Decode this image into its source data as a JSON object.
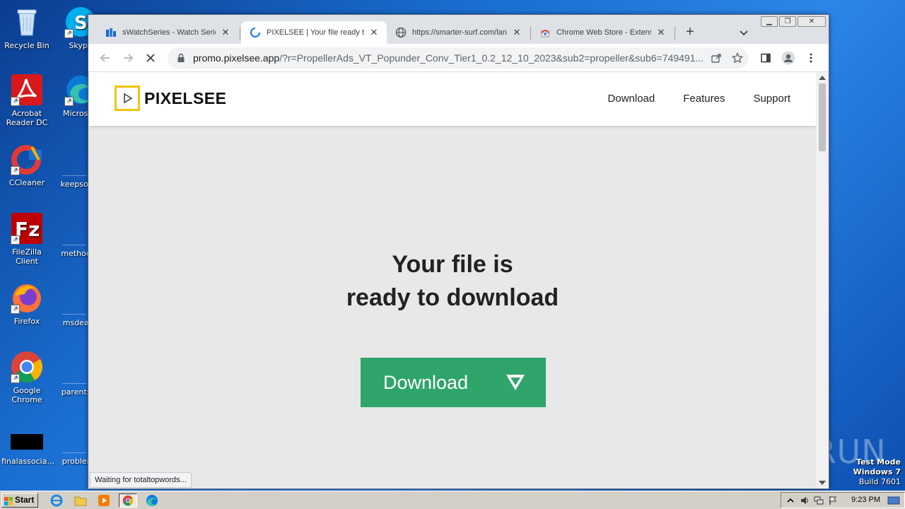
{
  "desktop": {
    "icons": [
      {
        "label": "Recycle Bin"
      },
      {
        "label": "Skype"
      },
      {
        "label": "Acrobat Reader DC"
      },
      {
        "label": "Microsoft"
      },
      {
        "label": "CCleaner"
      },
      {
        "label": "keepsome"
      },
      {
        "label": "FileZilla Client"
      },
      {
        "label": "methodsp"
      },
      {
        "label": "Firefox"
      },
      {
        "label": "msdeal.p"
      },
      {
        "label": "Google Chrome"
      },
      {
        "label": "parentsca"
      },
      {
        "label": "finalassocia..."
      },
      {
        "label": "problemd"
      }
    ]
  },
  "browser": {
    "tabs": [
      {
        "title": "sWatchSeries - Watch Series",
        "icon": "site-favicon",
        "active": false
      },
      {
        "title": "PIXELSEE | Your file ready to",
        "icon": "loading-spinner",
        "active": true
      },
      {
        "title": "https://smarter-surf.com/lan",
        "icon": "globe-icon",
        "active": false
      },
      {
        "title": "Chrome Web Store - Extensio",
        "icon": "chrome-web-store-icon",
        "active": false
      }
    ],
    "new_tab_label": "+",
    "url_host": "promo.pixelsee.app",
    "url_rest": "/?r=PropellerAds_VT_Popunder_Conv_Tier1_0.2_12_10_2023&sub2=propeller&sub6=749491...",
    "status_text": "Waiting for totaltopwords..."
  },
  "page": {
    "brand": "PIXELSEE",
    "nav": [
      "Download",
      "Features",
      "Support"
    ],
    "headline_line1": "Your file is",
    "headline_line2": "ready to download",
    "download_button": "Download",
    "accent_color": "#2fa56b",
    "logo_color": "#f1c40f"
  },
  "watermark": {
    "anyrun": "ANY RUN",
    "test_mode": "Test Mode",
    "os": "Windows 7",
    "build": "Build 7601"
  },
  "taskbar": {
    "start_label": "Start",
    "clock": "9:23 PM"
  }
}
